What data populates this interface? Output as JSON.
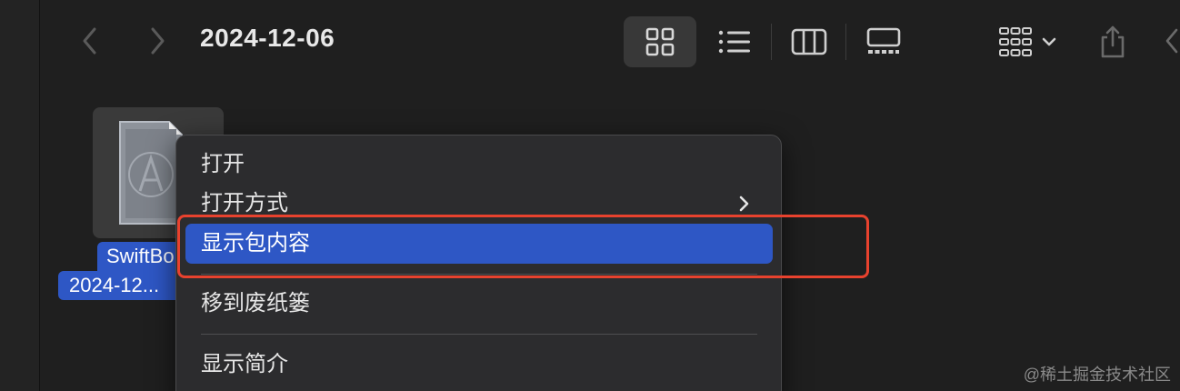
{
  "window": {
    "title": "2024-12-06"
  },
  "toolbar": {
    "back_icon": "chevron-left-icon",
    "forward_icon": "chevron-right-icon",
    "views": [
      {
        "name": "icon-view",
        "icon": "grid-icon",
        "active": true
      },
      {
        "name": "list-view",
        "icon": "list-icon",
        "active": false
      },
      {
        "name": "column-view",
        "icon": "columns-icon",
        "active": false
      },
      {
        "name": "gallery-view",
        "icon": "gallery-icon",
        "active": false
      }
    ],
    "group_icon": "group-icon",
    "share_icon": "share-icon"
  },
  "file": {
    "label_line1": "SwiftBo",
    "label_line2": "2024-12..."
  },
  "context_menu": {
    "items": [
      {
        "label": "打开"
      },
      {
        "label": "打开方式",
        "has_submenu": true
      },
      {
        "label": "显示包内容",
        "highlighted": true
      },
      {
        "label": "移到废纸篓"
      },
      {
        "label": "显示简介"
      }
    ]
  },
  "watermark": "@稀土掘金技术社区",
  "colors": {
    "accent": "#2e57c5",
    "annotation": "#e8422e",
    "background": "#1f1f1f"
  }
}
